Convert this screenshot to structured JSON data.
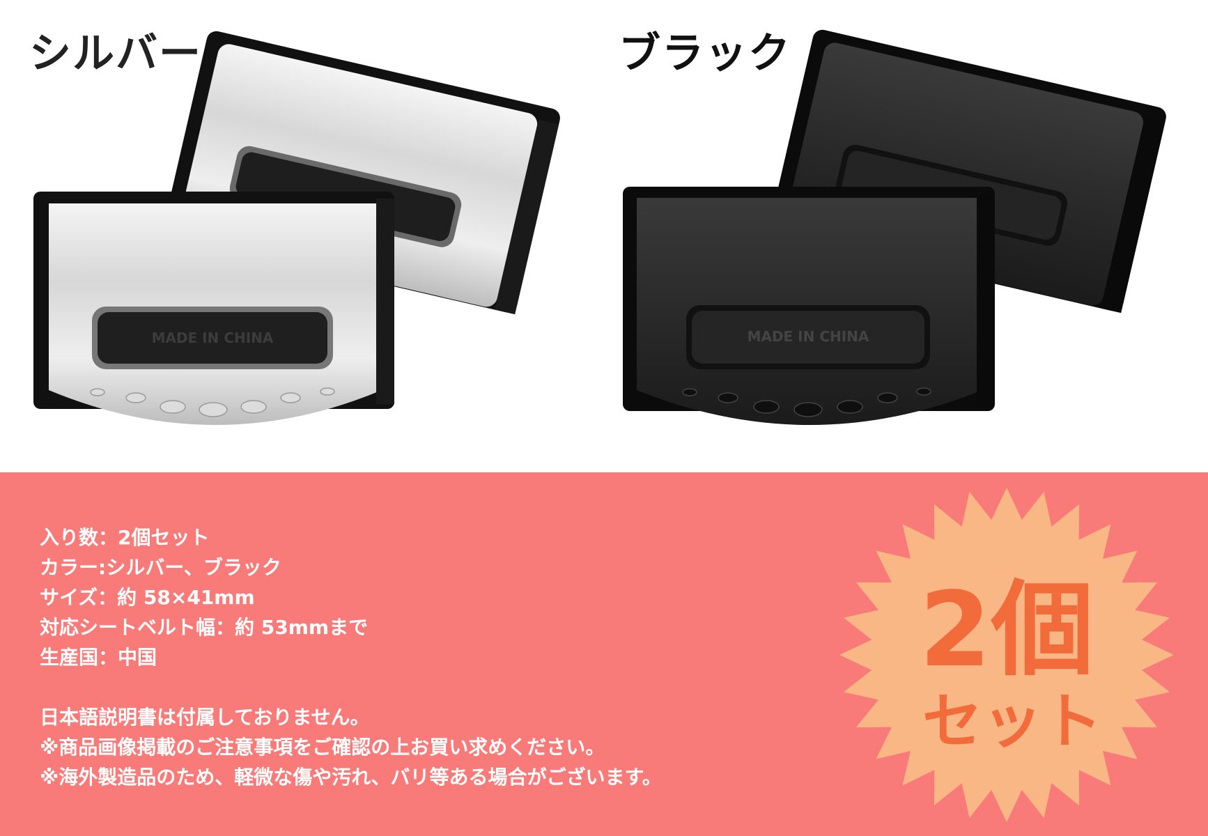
{
  "variants": {
    "silver_label": "シルバー",
    "black_label": "ブラック",
    "product_imprint": "MADE IN CHINA"
  },
  "specs": {
    "quantity": "入り数：2個セット",
    "color": "カラー:シルバー、ブラック",
    "size": "サイズ：約 58×41mm",
    "belt_width": "対応シートベルト幅：約 53mmまで",
    "origin": "生産国：中国"
  },
  "notes": {
    "line1": "日本語説明書は付属しておりません。",
    "line2": "※商品画像掲載のご注意事項をご確認の上お買い求めください。",
    "line3": "※海外製造品のため、軽微な傷や汚れ、バリ等ある場合がございます。"
  },
  "badge": {
    "main": "2個",
    "sub": "セット"
  },
  "colors": {
    "panel_bg": "#f87b79",
    "badge_fill": "#f8b784",
    "badge_text": "#f26b3a"
  }
}
